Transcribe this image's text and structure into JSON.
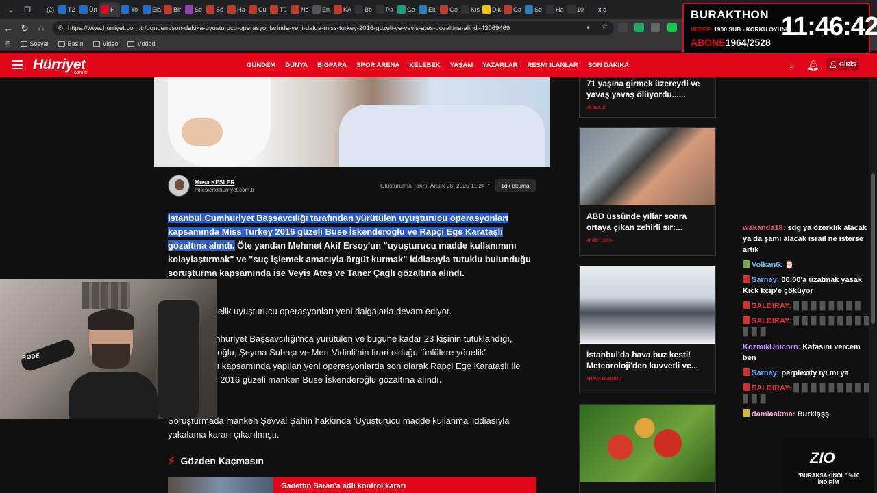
{
  "browser": {
    "url": "https://www.hurriyet.com.tr/gundem/son-dakika-uyusturucu-operasyonlarinda-yeni-dalga-miss-turkey-2016-guzeli-ve-veyis-ates-gozaltina-alindi-43069469",
    "tabs": [
      {
        "label": "(2)",
        "color": "#222"
      },
      {
        "label": "T2",
        "color": "#1f6fd1"
      },
      {
        "label": "Ün",
        "color": "#1f6fd1"
      },
      {
        "label": "H",
        "color": "#e3061b"
      },
      {
        "label": "Yo",
        "color": "#1f6fd1"
      },
      {
        "label": "Ela",
        "color": "#1f6fd1"
      },
      {
        "label": "Bir",
        "color": "#c0392b"
      },
      {
        "label": "So",
        "color": "#8e44ad"
      },
      {
        "label": "Sö",
        "color": "#c0392b"
      },
      {
        "label": "Ha",
        "color": "#c0392b"
      },
      {
        "label": "Cu",
        "color": "#c0392b"
      },
      {
        "label": "Tü",
        "color": "#c0392b"
      },
      {
        "label": "Ne",
        "color": "#c0392b"
      },
      {
        "label": "En",
        "color": "#555"
      },
      {
        "label": "KA",
        "color": "#c0392b"
      },
      {
        "label": "Bb",
        "color": "#333"
      },
      {
        "label": "Pa",
        "color": "#333"
      },
      {
        "label": "Ga",
        "color": "#16a085"
      },
      {
        "label": "Ek",
        "color": "#2980b9"
      },
      {
        "label": "Ge",
        "color": "#c0392b"
      },
      {
        "label": "Kıs",
        "color": "#333"
      },
      {
        "label": "Dik",
        "color": "#f1c40f"
      },
      {
        "label": "Ga",
        "color": "#c0392b"
      },
      {
        "label": "So",
        "color": "#2980b9"
      },
      {
        "label": "Ha",
        "color": "#333"
      },
      {
        "label": "10",
        "color": "#333"
      },
      {
        "label": "x.c",
        "color": "#222"
      }
    ],
    "bookmarks": [
      "Sosyal",
      "Basın",
      "Video",
      "Vdddd"
    ]
  },
  "site": {
    "logo": "Hürriyet",
    "logo_sub": "com.tr",
    "nav": [
      "GÜNDEM",
      "DÜNYA",
      "BİGPARA",
      "SPOR ARENA",
      "KELEBEK",
      "YAŞAM",
      "YAZARLAR",
      "RESMİ İLANLAR",
      "SON DAKİKA"
    ],
    "login": "GİRİŞ"
  },
  "article": {
    "author_name": "Musa KESLER",
    "author_email": "mkesler@hurriyet.com.tr",
    "created": "Oluşturulma Tarihi: Aralık 28, 2025 11:24",
    "read_time": "1dk okuma",
    "lead_highlighted": "İstanbul Cumhuriyet Başsavcılığı tarafından yürütülen uyuşturucu operasyonları kapsamında Miss Turkey 2016 güzeli Buse İskenderoğlu ve Rapçi Ege Karataşlı gözaltına alındı.",
    "lead_rest": " Öte yandan Mehmet Akif Ersoy'un \"uyuşturucu madde kullanımını kolaylaştırmak\" ve \"suç işlemek amacıyla örgüt kurmak\" iddiasıyla tutuklu bulunduğu soruşturma kapsamında ise Veyis Ateş ve Taner Çağlı gözaltına alındı.",
    "p2": "Ünlülere yönelik uyuşturucu operasyonları yeni dalgalarla devam ediyor.",
    "p3": "İstanbul Cumhuriyet Başsavcılığı'nca yürütülen ve bugüne kadar 23 kişinin tutuklandığı, Kasım Garipoğlu, Şeyma Subaşı ve Mert Vidinli'nin firari olduğu 'ünlülere yönelik' soruşturması kapsamında yapılan yeni operasyonlarda son olarak Rapçi Ege Karataşlı ile Miss Türkiye 2016 güzeli manken Buse İskenderoğlu gözaltına alındı.",
    "p4": "Soruşturmada manken Şevval Şahin hakkında 'Uyuşturucu madde kullanma' iddiasıyla yakalama kararı çıkarılmıştı.",
    "section_title": "Gözden Kaçmasın",
    "related_title": "Sadettin Saran'a adli kontrol kararı"
  },
  "sidebar": [
    {
      "title": "71 yaşına girmek üzereydi ve yavaş yavaş ölüyordu......",
      "tag": "#SAĞLIK"
    },
    {
      "title": "ABD üssünde yıllar sonra ortaya çıkan zehirli sır:...",
      "tag": "#FORT ORD"
    },
    {
      "title": "İstanbul'da hava buz kesti! Meteoroloji'den kuvvetli ve...",
      "tag": "#HAVA DURUMU"
    },
    {
      "title": "",
      "tag": ""
    }
  ],
  "stream": {
    "title": "BURAKTHON",
    "hedef_label": "HEDEF:",
    "hedef_value": "1900 SUB - KORKU OYUNU",
    "abone_label": "ABONE",
    "abone_value": "1964/2528",
    "clock": "11:46:42",
    "mic_label": "RØDE",
    "sponsor_logo": "ZIO",
    "sponsor_text": "\"BURAKSAKINOL\" %10 İNDİRİM"
  },
  "chat": [
    {
      "user": "wakanda18:",
      "color": "#e05d6f",
      "text": "sdg ya özerklik alacak ya da şamı alacak israil ne isterse artık",
      "badge": ""
    },
    {
      "user": "Volkan6:",
      "color": "#58c7ff",
      "text": "🎅",
      "badge": "#7a5"
    },
    {
      "user": "Sarney:",
      "color": "#6aa6ff",
      "text": "00:00'a uzatmak yasak Kick kcip'e çöküyor",
      "badge": "#c33"
    },
    {
      "user": "SALDIRAY:",
      "color": "#e0303f",
      "text": "█ █ █ █ █ █ █ █",
      "badge": "#c33"
    },
    {
      "user": "SALDIRAY:",
      "color": "#e0303f",
      "text": "█ █ █ █ █ █ █ █ █ █ █ █",
      "badge": "#c33"
    },
    {
      "user": "KozmikUnicorn:",
      "color": "#c48dff",
      "text": "Kafasını vercem ben",
      "badge": ""
    },
    {
      "user": "Sarney:",
      "color": "#6aa6ff",
      "text": "perplexity iyi mi ya",
      "badge": "#c33"
    },
    {
      "user": "SALDIRAY:",
      "color": "#e0303f",
      "text": "█ █ █ █ █ █ █ █ █ █ █ █",
      "badge": "#c33"
    },
    {
      "user": "damlaakma:",
      "color": "#ff9ecf",
      "text": "Burkişşş",
      "badge": "#cb3"
    }
  ]
}
